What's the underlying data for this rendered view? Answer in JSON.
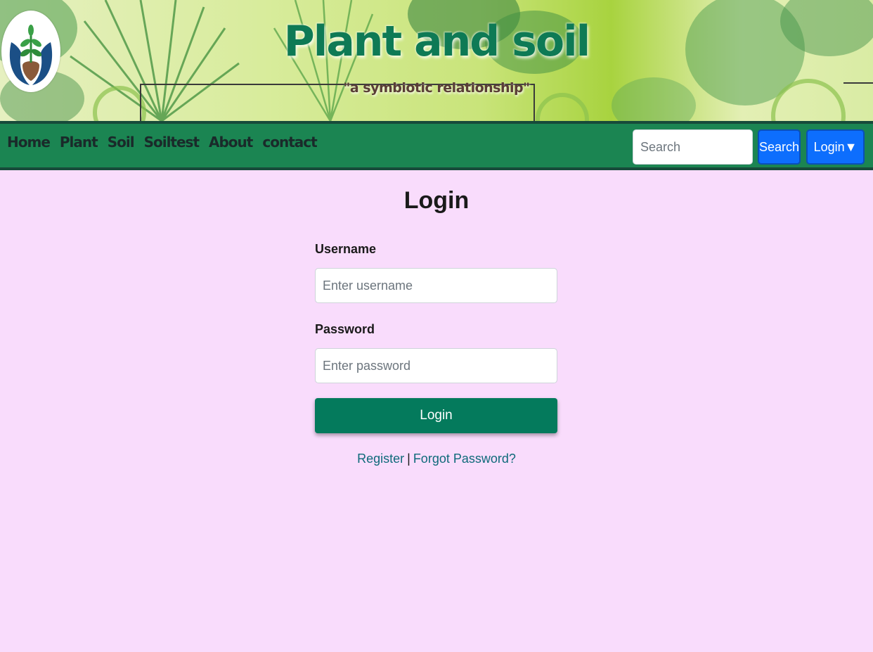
{
  "header": {
    "title": "Plant and soil",
    "tagline": "\"a symbiotic relationship\""
  },
  "nav": {
    "items": [
      "Home",
      "Plant",
      "Soil",
      "Soiltest",
      "About",
      "contact"
    ],
    "search_placeholder": "Search",
    "search_button": "Search",
    "login_button": "Login▼"
  },
  "login_form": {
    "heading": "Login",
    "username_label": "Username",
    "username_placeholder": "Enter username",
    "password_label": "Password",
    "password_placeholder": "Enter password",
    "submit_label": "Login",
    "register_link": "Register",
    "separator": "|",
    "forgot_link": "Forgot Password?"
  },
  "colors": {
    "page_background": "#f9dcfc",
    "navbar": "#1b8552",
    "primary_blue": "#0d6efd",
    "submit_green": "#047a5c",
    "title_green": "#0e7a55"
  },
  "icons": {
    "logo": "plant-in-hands-logo"
  }
}
